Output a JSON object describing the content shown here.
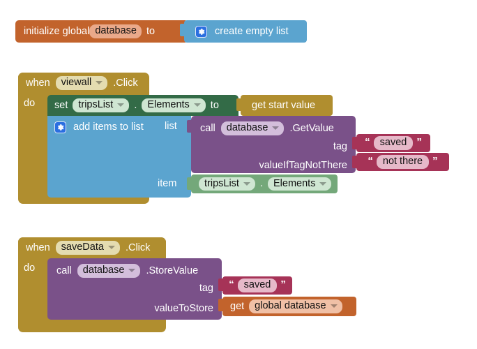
{
  "editor": {
    "name": "MIT App Inventor Blocks Editor",
    "background": "#ffffff"
  },
  "palette": {
    "variable_orange": "#c2632c",
    "variable_orange_field": "#eaa98a",
    "list_blue": "#5ba4cf",
    "event_gold": "#b08e2f",
    "event_gold_field": "#e4dcb0",
    "setter_green_dark": "#336b47",
    "getter_green_light": "#74a87a",
    "component_purple": "#7a5189",
    "text_red": "#a63357",
    "gear_blue": "#2b6fe0"
  },
  "blocks": {
    "init_global": {
      "keyword": "initialize global",
      "variable_name": "database",
      "to_label": "to",
      "value_block": {
        "label": "create empty list",
        "gear_icon": "gear-icon"
      }
    },
    "event_viewall": {
      "when_label": "when",
      "component": "viewall",
      "event": ".Click",
      "do_label": "do",
      "statements": {
        "set_block": {
          "set_label": "set",
          "component": "tripsList",
          "dot": ".",
          "property": "Elements",
          "to_label": "to",
          "value": {
            "label": "get start value"
          }
        },
        "add_items_block": {
          "gear_icon": "gear-icon",
          "label": "add items to list",
          "list_label": "list",
          "item_label": "item",
          "list_value": {
            "call_label": "call",
            "component": "database",
            "method": ".GetValue",
            "args": [
              {
                "name": "tag",
                "value": "saved",
                "open_quote": "“",
                "close_quote": "”"
              },
              {
                "name": "valueIfTagNotThere",
                "value": "not there",
                "open_quote": "“",
                "close_quote": "”"
              }
            ]
          },
          "item_value": {
            "component": "tripsList",
            "dot": ".",
            "property": "Elements"
          }
        }
      }
    },
    "event_savedata": {
      "when_label": "when",
      "component": "saveData",
      "event": ".Click",
      "do_label": "do",
      "statements": {
        "call_block": {
          "call_label": "call",
          "component": "database",
          "method": ".StoreValue",
          "args": [
            {
              "name": "tag",
              "value": "saved",
              "open_quote": "“",
              "close_quote": "”"
            },
            {
              "name": "valueToStore",
              "getter": {
                "get_label": "get",
                "variable": "global database"
              }
            }
          ]
        }
      }
    }
  }
}
